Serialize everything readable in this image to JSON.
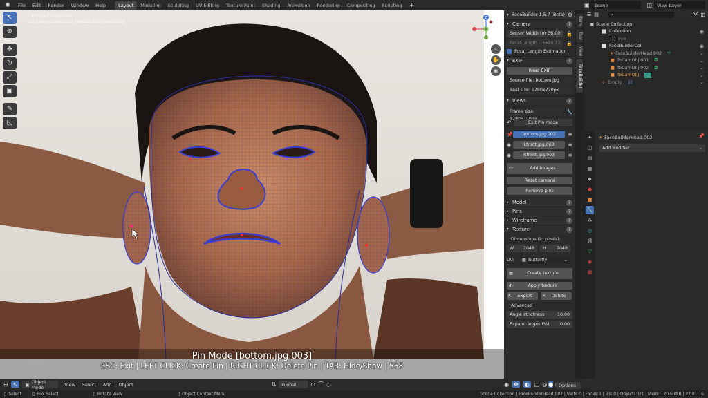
{
  "topbar": {
    "menus": [
      "File",
      "Edit",
      "Render",
      "Window",
      "Help"
    ],
    "workspaces": [
      "Layout",
      "Modeling",
      "Sculpting",
      "UV Editing",
      "Texture Paint",
      "Shading",
      "Animation",
      "Rendering",
      "Compositing",
      "Scripting"
    ],
    "active_workspace": "Layout",
    "scene": "Scene",
    "view_layer": "View Layer"
  },
  "viewport": {
    "view_name": "Camera Perspective",
    "collection_info": "(1) Scene Collection | FaceBuilderHead.002",
    "overlay_title": "Pin Mode  [bottom.jpg.003]",
    "overlay_help": "ESC: Exit | LEFT CLICK: Create Pin | RIGHT CLICK: Delete Pin | TAB: Hide/Show | 558",
    "pinmode_label": "Pin Mode",
    "gizmo": {
      "x": "X",
      "y": "Y",
      "z": "Z"
    }
  },
  "npanel": {
    "title": "FaceBuilder 1.5.7 (Beta)",
    "camera": {
      "header": "Camera",
      "sensor_width_label": "Sensor Width (m",
      "sensor_width_value": "36.00",
      "focal_length_label": "Focal Length",
      "focal_length_value": "5624.73",
      "focal_estimation": "Focal Length Estimation"
    },
    "exif": {
      "header": "EXIF",
      "read_btn": "Read EXIF",
      "source": "Source file: bottom.jpg",
      "real_size": "Real size: 1280x720px"
    },
    "views": {
      "header": "Views",
      "frame_size": "Frame size: 1280x720px",
      "exit_pin": "Exit Pin mode",
      "items": [
        "bottom.jpg.003",
        "Lfront.jpg.003",
        "Rfront.jpg.003"
      ],
      "add_images": "Add Images",
      "reset_camera": "Reset camera",
      "remove_pins": "Remove pins"
    },
    "collapsed": [
      "Model",
      "Pins",
      "Wireframe"
    ],
    "texture": {
      "header": "Texture",
      "dimensions": "Dimensions (in pixels):",
      "w_label": "W",
      "w_value": "2048",
      "h_label": "H",
      "h_value": "2048",
      "uv_label": "UV:",
      "uv_value": "Butterfly",
      "create": "Create texture",
      "apply": "Apply texture",
      "export": "Export",
      "delete": "Delete",
      "advanced": "Advanced",
      "angle_label": "Angle strictness",
      "angle_value": "10.00",
      "expand_label": "Expand edges (%)",
      "expand_value": "0.00"
    }
  },
  "sidetabs": [
    "Item",
    "Tool",
    "View",
    "FaceBuilder"
  ],
  "outliner": {
    "root": "Scene Collection",
    "rows": [
      {
        "name": "Collection",
        "indent": 1
      },
      {
        "name": "eye",
        "indent": 2
      },
      {
        "name": "FaceBuilderCol",
        "indent": 1
      },
      {
        "name": "FaceBuilderHead.002",
        "indent": 2
      },
      {
        "name": "fbCamObj.001",
        "indent": 2
      },
      {
        "name": "fbCamObj.002",
        "indent": 2
      },
      {
        "name": "fbCamObj",
        "indent": 2
      },
      {
        "name": "Empty",
        "indent": 1
      }
    ]
  },
  "properties": {
    "object_name": "FaceBuilderHead.002",
    "add_modifier": "Add Modifier"
  },
  "bottombar": {
    "mode": "Object Mode",
    "menus": [
      "View",
      "Select",
      "Add",
      "Object"
    ],
    "orientation": "Global",
    "options": "Options"
  },
  "statusbar": {
    "select": "Select",
    "box_select": "Box Select",
    "rotate_view": "Rotate View",
    "context_menu": "Object Context Menu",
    "stats": "Scene Collection | FaceBuilderHead.002 | Verts:0 | Faces:0 | Tris:0 | Objects:1/1 | Mem: 120.6 MiB | v2.81.16"
  },
  "colors": {
    "accent": "#4772b3",
    "mesh": "#2b2f9a"
  }
}
